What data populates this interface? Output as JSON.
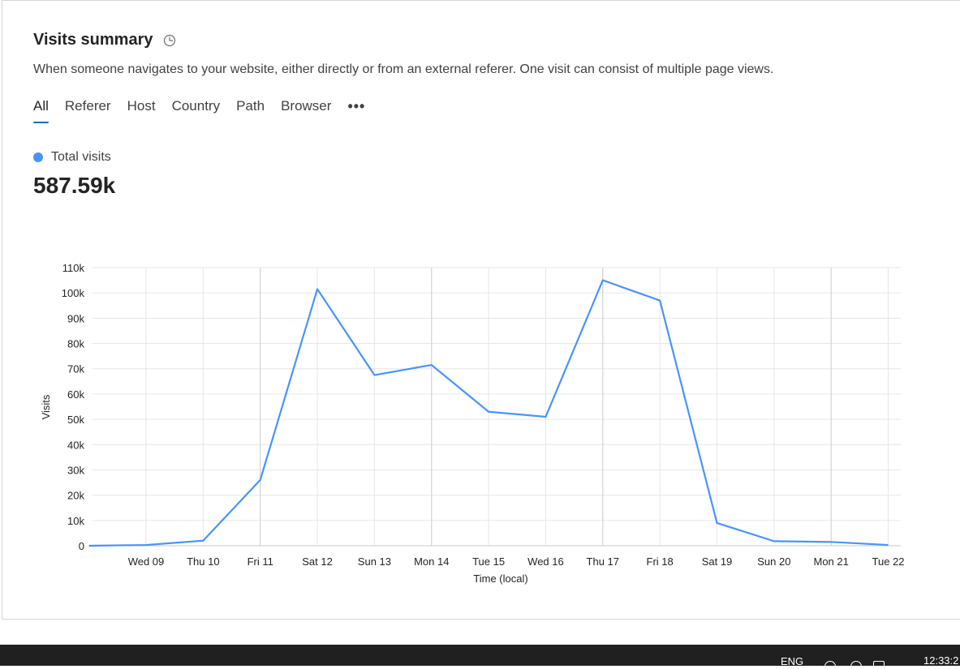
{
  "card": {
    "title": "Visits summary",
    "subtitle": "When someone navigates to your website, either directly or from an external referer. One visit can consist of multiple page views.",
    "title_icon": "clock-icon"
  },
  "tabs": [
    "All",
    "Referer",
    "Host",
    "Country",
    "Path",
    "Browser"
  ],
  "tabs_active": "All",
  "more_icon": "more-horizontal-icon",
  "legend": {
    "label": "Total visits",
    "color": "#4894fe"
  },
  "total_value": "587.59k",
  "chart_data": {
    "type": "line",
    "xlabel": "Time (local)",
    "ylabel": "Visits",
    "ylim": [
      0,
      110000
    ],
    "yticks": [
      0,
      10000,
      20000,
      30000,
      40000,
      50000,
      60000,
      70000,
      80000,
      90000,
      100000,
      110000
    ],
    "ytick_labels": [
      "0",
      "10k",
      "20k",
      "30k",
      "40k",
      "50k",
      "60k",
      "70k",
      "80k",
      "90k",
      "100k",
      "110k"
    ],
    "xtick_labels": [
      "Wed 09",
      "Thu 10",
      "Fri 11",
      "Sat 12",
      "Sun 13",
      "Mon 14",
      "Tue 15",
      "Wed 16",
      "Thu 17",
      "Fri 18",
      "Sat 19",
      "Sun 20",
      "Mon 21",
      "Tue 22"
    ],
    "grid": true,
    "series": [
      {
        "name": "Total visits",
        "color": "#4894fe",
        "points": [
          {
            "x": "Tue 08 12:00",
            "y": 0
          },
          {
            "x": "Wed 09 12:00",
            "y": 300
          },
          {
            "x": "Thu 10 12:00",
            "y": 2000
          },
          {
            "x": "Fri 11 12:00",
            "y": 26000
          },
          {
            "x": "Sat 12 12:00",
            "y": 101500
          },
          {
            "x": "Sun 13 12:00",
            "y": 67500
          },
          {
            "x": "Mon 14 12:00",
            "y": 71500
          },
          {
            "x": "Tue 15 12:00",
            "y": 53000
          },
          {
            "x": "Wed 16 12:00",
            "y": 51000
          },
          {
            "x": "Thu 17 12:00",
            "y": 105000
          },
          {
            "x": "Fri 18 12:00",
            "y": 97000
          },
          {
            "x": "Sat 19 12:00",
            "y": 9000
          },
          {
            "x": "Sun 20 12:00",
            "y": 1800
          },
          {
            "x": "Mon 21 12:00",
            "y": 1500
          },
          {
            "x": "Tue 22 12:00",
            "y": 300
          }
        ]
      }
    ]
  },
  "taskbar": {
    "language": "ENG",
    "clock": "12:33:2"
  }
}
